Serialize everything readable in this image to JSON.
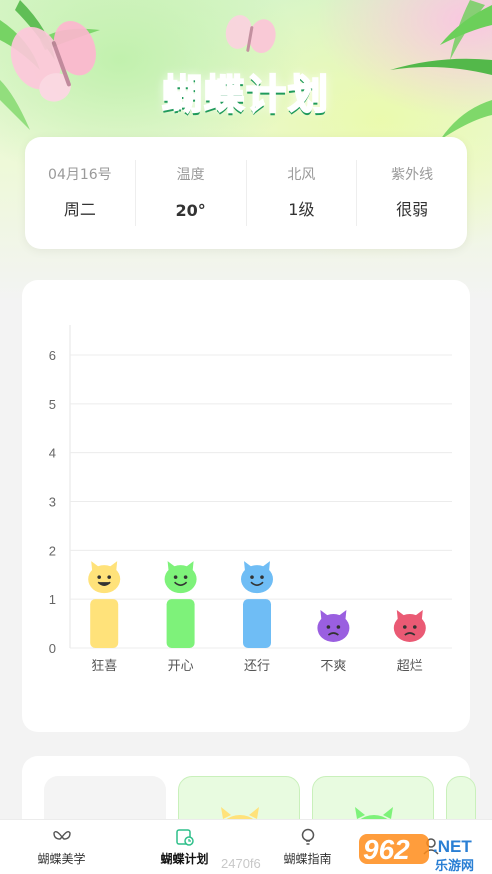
{
  "header": {
    "title": "蝴蝶计划"
  },
  "weather": [
    {
      "label": "04月16号",
      "value": "周二",
      "bold": false
    },
    {
      "label": "温度",
      "value": "20°",
      "bold": true
    },
    {
      "label": "北风",
      "value": "1级",
      "bold": false
    },
    {
      "label": "紫外线",
      "value": "很弱",
      "bold": false
    }
  ],
  "chart_data": {
    "type": "bar",
    "categories": [
      "狂喜",
      "开心",
      "还行",
      "不爽",
      "超烂"
    ],
    "values": [
      1,
      1,
      1,
      0,
      0
    ],
    "ylim": [
      0,
      6
    ],
    "yticks": [
      "0",
      "1",
      "2",
      "3",
      "4",
      "5",
      "6"
    ],
    "colors": [
      "#ffe27a",
      "#7ef27a",
      "#6fbdf5",
      "#9a5fe0",
      "#ea5a74"
    ],
    "grid": true
  },
  "nav": {
    "items": [
      {
        "label": "蝴蝶美学",
        "icon": "butterfly-icon",
        "active": false
      },
      {
        "label": "蝴蝶计划",
        "icon": "calendar-clock-icon",
        "active": true
      },
      {
        "label": "蝴蝶指南",
        "icon": "lightbulb-icon",
        "active": false
      },
      {
        "label": "",
        "icon": "person-icon",
        "active": false
      }
    ]
  },
  "watermark": {
    "text": "962",
    "suffix": ".NET",
    "sub": "乐游网"
  },
  "footer_id": "2470f6"
}
